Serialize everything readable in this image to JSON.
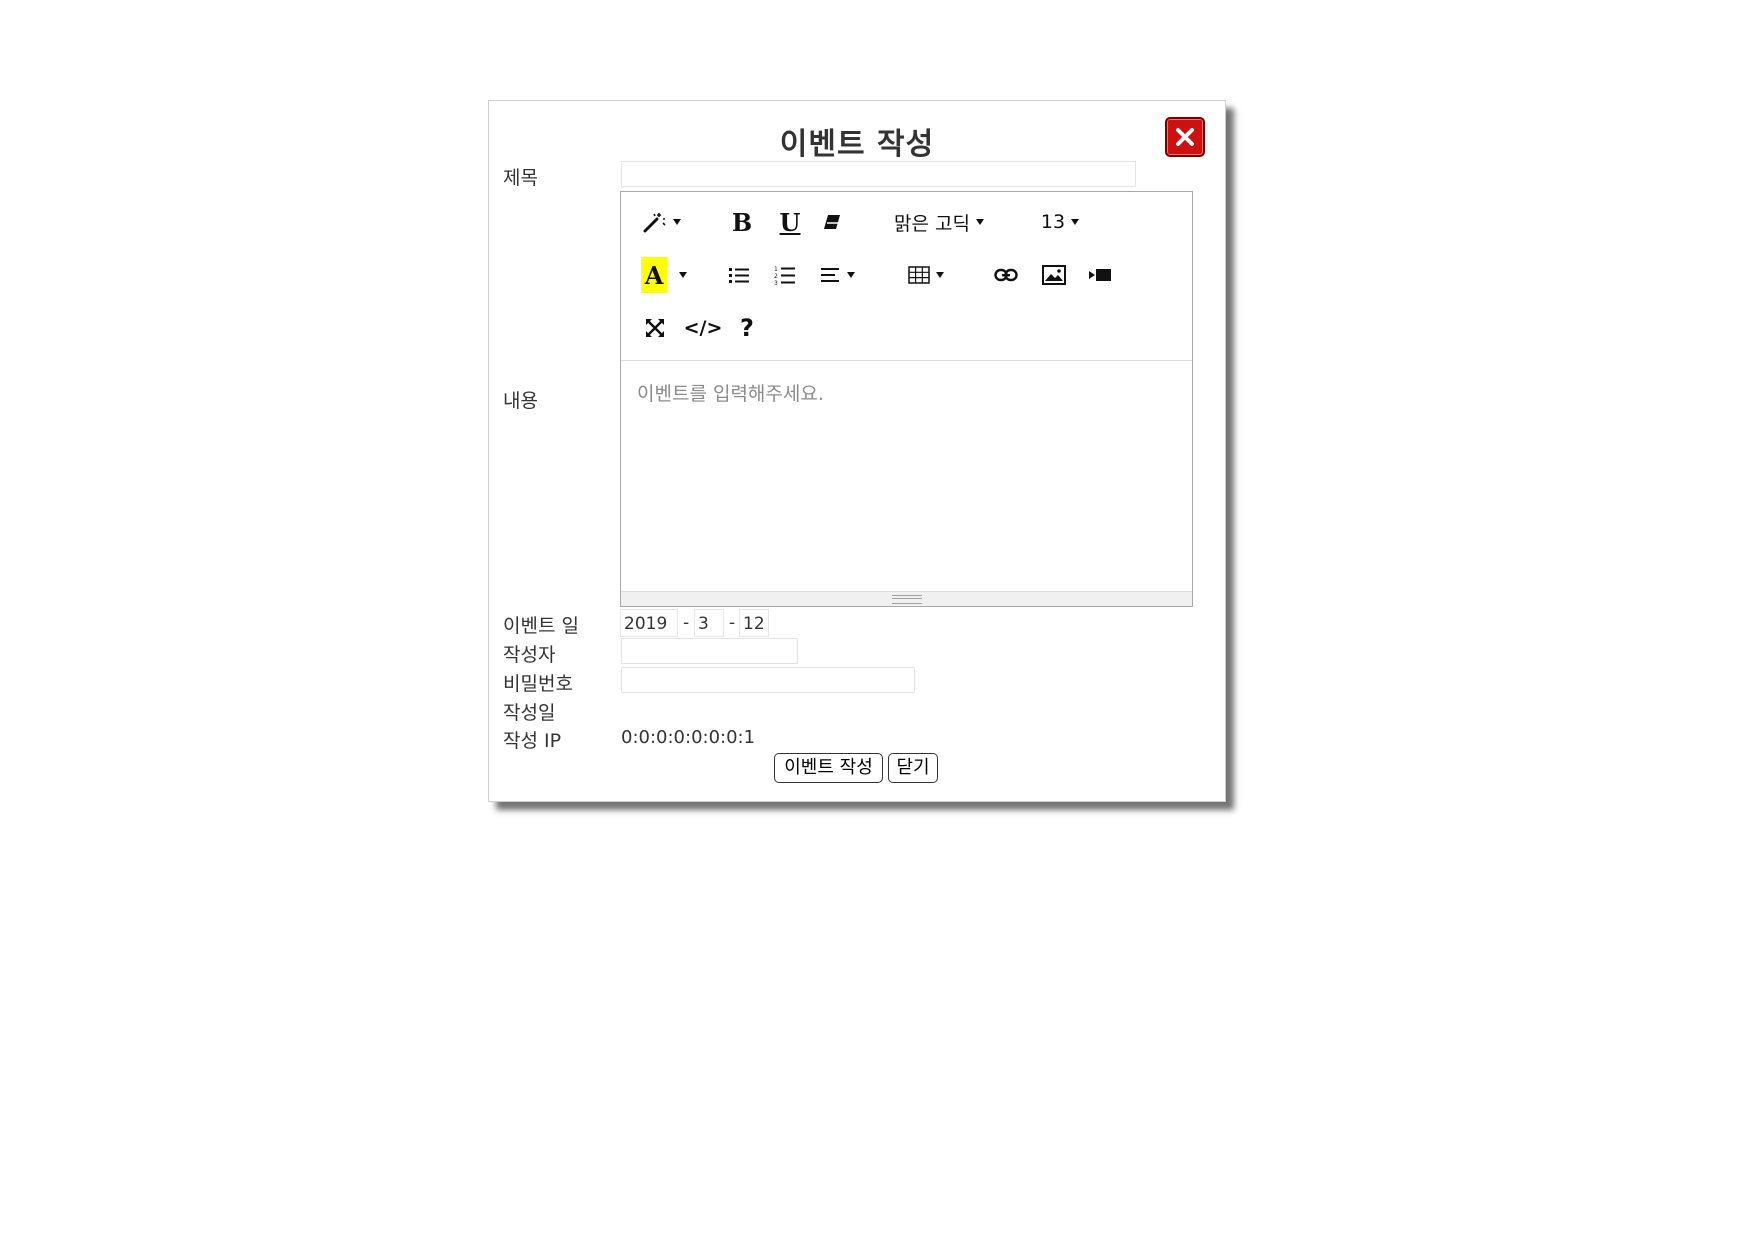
{
  "modal": {
    "title": "이벤트 작성",
    "close_icon": "close-x-icon"
  },
  "form": {
    "title_label": "제목",
    "title_value": "",
    "content_label": "내용",
    "event_date_label": "이벤트 일",
    "event_date": {
      "year": "2019",
      "sep1": "-",
      "month": "3",
      "sep2": "-",
      "day": "12"
    },
    "author_label": "작성자",
    "author_value": "",
    "password_label": "비밀번호",
    "password_value": "",
    "created_label": "작성일",
    "created_value": "",
    "ip_label": "작성 IP",
    "ip_value": "0:0:0:0:0:0:0:1"
  },
  "editor": {
    "placeholder": "이벤트를 입력해주세요.",
    "font_name": "맑은 고딕",
    "font_size": "13",
    "bold_label": "B",
    "underline_label": "U",
    "color_label": "A",
    "codeview_label": "</>",
    "help_label": "?",
    "highlight_color": "#ffff00",
    "icons": [
      "magic-style-icon",
      "bold-icon",
      "underline-icon",
      "eraser-icon",
      "font-family-dropdown",
      "font-size-dropdown",
      "text-color-icon",
      "unordered-list-icon",
      "ordered-list-icon",
      "align-icon",
      "table-icon",
      "link-icon",
      "image-icon",
      "video-icon",
      "fullscreen-icon",
      "code-view-icon",
      "help-icon"
    ]
  },
  "buttons": {
    "submit_label": "이벤트 작성",
    "close_label": "닫기"
  },
  "colors": {
    "close_button": "#cc1111"
  }
}
